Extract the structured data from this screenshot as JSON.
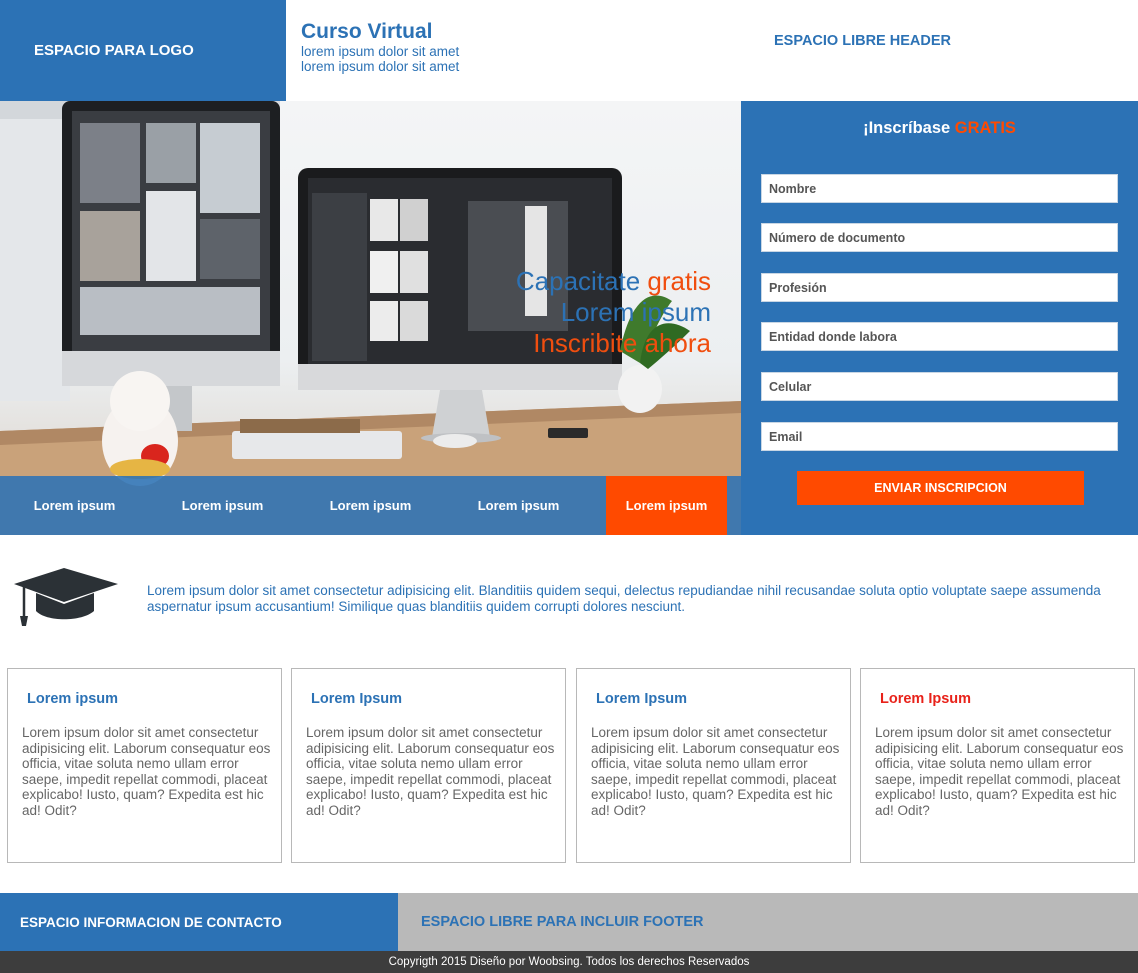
{
  "header": {
    "logo_text": "ESPACIO PARA LOGO",
    "course_title": "Curso Virtual",
    "course_subtitle_1": "lorem ipsum dolor sit amet",
    "course_subtitle_2": "lorem ipsum dolor sit amet",
    "free_space": "ESPACIO LIBRE HEADER"
  },
  "hero": {
    "line1_blue": "Capacitate ",
    "line1_orange": "gratis",
    "line2": "Lorem ipsum",
    "line3": "Inscribite ahora",
    "image_icon": "desk-computers-photo"
  },
  "nav": {
    "items": [
      {
        "label": "Lorem ipsum",
        "active": false
      },
      {
        "label": "Lorem ipsum",
        "active": false
      },
      {
        "label": "Lorem ipsum",
        "active": false
      },
      {
        "label": "Lorem ipsum",
        "active": false
      },
      {
        "label": "Lorem ipsum",
        "active": true
      }
    ]
  },
  "form": {
    "title_prefix": "¡Inscríbase ",
    "title_highlight": "GRATIS",
    "fields": [
      {
        "placeholder": "Nombre",
        "value": ""
      },
      {
        "placeholder": "Número de documento",
        "value": ""
      },
      {
        "placeholder": "Profesión",
        "value": ""
      },
      {
        "placeholder": "Entidad donde labora",
        "value": ""
      },
      {
        "placeholder": "Celular",
        "value": ""
      },
      {
        "placeholder": "Email",
        "value": ""
      }
    ],
    "submit_label": "ENVIAR INSCRIPCION"
  },
  "intro": {
    "icon": "graduation-cap-icon",
    "text": "Lorem ipsum dolor sit amet consectetur adipisicing elit. Blanditiis quidem sequi, delectus repudiandae nihil recusandae soluta optio voluptate saepe assumenda aspernatur ipsum accusantium! Similique quas blanditiis quidem corrupti dolores nesciunt."
  },
  "cards": [
    {
      "title": "Lorem ipsum",
      "text": "Lorem ipsum dolor sit amet consectetur adipisicing elit. Laborum consequatur eos officia, vitae soluta nemo ullam error saepe, impedit repellat commodi, placeat explicabo! Iusto, quam? Expedita est hic ad! Odit?"
    },
    {
      "title": "Lorem Ipsum",
      "text": "Lorem ipsum dolor sit amet consectetur adipisicing elit. Laborum consequatur eos officia, vitae soluta nemo ullam error saepe, impedit repellat commodi, placeat explicabo! Iusto, quam? Expedita est hic ad! Odit?"
    },
    {
      "title": "Lorem Ipsum",
      "text": "Lorem ipsum dolor sit amet consectetur adipisicing elit. Laborum consequatur eos officia, vitae soluta nemo ullam error saepe, impedit repellat commodi, placeat explicabo! Iusto, quam? Expedita est hic ad! Odit?"
    },
    {
      "title": "Lorem Ipsum",
      "text": "Lorem ipsum dolor sit amet consectetur adipisicing elit. Laborum consequatur eos officia, vitae soluta nemo ullam error saepe, impedit repellat commodi, placeat explicabo! Iusto, quam? Expedita est hic ad! Odit?"
    }
  ],
  "footer": {
    "contact": "ESPACIO INFORMACION DE CONTACTO",
    "free_space": "ESPACIO LIBRE PARA INCLUIR FOOTER",
    "copyright": "Copyrigth 2015 Diseño por Woobsing. Todos los derechos Reservados"
  },
  "colors": {
    "primary": "#2c72b5",
    "accent": "#ff4a00",
    "card_title_highlight": "#e8221a",
    "footer_gray": "#b9b9b9",
    "copyright_bg": "#3d3d3d"
  }
}
